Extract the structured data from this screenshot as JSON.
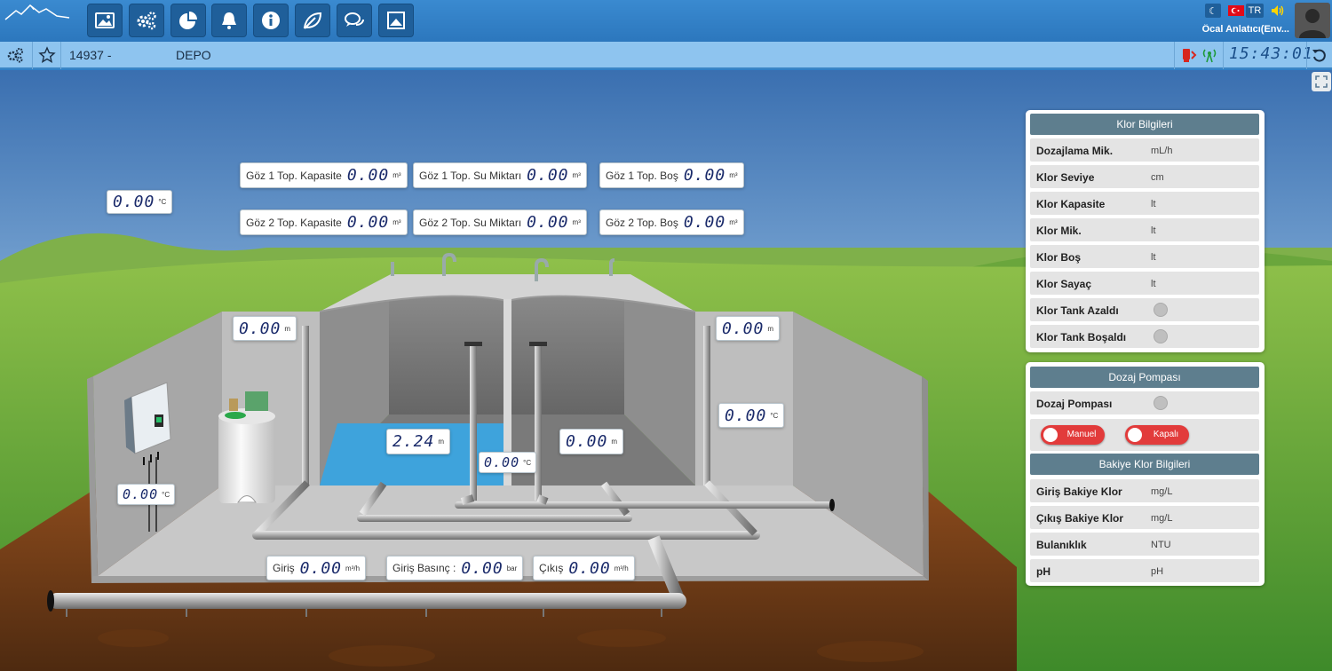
{
  "header": {
    "nav_icons": [
      "image-icon",
      "settings-icon",
      "pie-chart-icon",
      "bell-icon",
      "info-icon",
      "leaf-icon",
      "chat-icon",
      "picture-icon"
    ],
    "lang": "TR",
    "user": "Öcal Anlatıcı(Env..."
  },
  "subbar": {
    "station_id": "14937 -",
    "station_name": "DEPO",
    "clock": "15:43:01"
  },
  "scene": {
    "temp_outside": {
      "value": "0.00",
      "unit": "°C"
    },
    "goz1_kapasite": {
      "label": "Göz 1 Top. Kapasite",
      "value": "0.00",
      "unit": "m³"
    },
    "goz1_su": {
      "label": "Göz 1 Top. Su Miktarı",
      "value": "0.00",
      "unit": "m³"
    },
    "goz1_bos": {
      "label": "Göz 1 Top. Boş",
      "value": "0.00",
      "unit": "m³"
    },
    "goz2_kapasite": {
      "label": "Göz 2 Top. Kapasite",
      "value": "0.00",
      "unit": "m³"
    },
    "goz2_su": {
      "label": "Göz 2 Top. Su Miktarı",
      "value": "0.00",
      "unit": "m³"
    },
    "goz2_bos": {
      "label": "Göz 2 Top. Boş",
      "value": "0.00",
      "unit": "m³"
    },
    "level_left": {
      "value": "0.00",
      "unit": "m"
    },
    "level_right": {
      "value": "0.00",
      "unit": "m"
    },
    "temp_right": {
      "value": "0.00",
      "unit": "°C"
    },
    "level_water": {
      "value": "2.24",
      "unit": "m"
    },
    "temp_water": {
      "value": "0.00",
      "unit": "°C"
    },
    "level_tank2": {
      "value": "0.00",
      "unit": "m"
    },
    "temp_panel": {
      "value": "0.00",
      "unit": "°C"
    },
    "giris": {
      "label": "Giriş",
      "value": "0.00",
      "unit": "m³/h"
    },
    "giris_basinc": {
      "label": "Giriş Basınç :",
      "value": "0.00",
      "unit": "bar"
    },
    "cikis": {
      "label": "Çıkış",
      "value": "0.00",
      "unit": "m³/h"
    }
  },
  "klor": {
    "title": "Klor Bilgileri",
    "rows": [
      {
        "k": "Dozajlama Mik.",
        "u": "mL/h"
      },
      {
        "k": "Klor Seviye",
        "u": "cm"
      },
      {
        "k": "Klor Kapasite",
        "u": "lt"
      },
      {
        "k": "Klor Mik.",
        "u": "lt"
      },
      {
        "k": "Klor Boş",
        "u": "lt"
      },
      {
        "k": "Klor Sayaç",
        "u": "lt"
      },
      {
        "k": "Klor Tank Azaldı",
        "u": ""
      },
      {
        "k": "Klor Tank Boşaldı",
        "u": ""
      }
    ]
  },
  "dozaj": {
    "title": "Dozaj Pompası",
    "row": "Dozaj Pompası",
    "mode": "Manuel",
    "state": "Kapalı"
  },
  "bakiye": {
    "title": "Bakiye Klor Bilgileri",
    "rows": [
      {
        "k": "Giriş Bakiye Klor",
        "u": "mg/L"
      },
      {
        "k": "Çıkış Bakiye Klor",
        "u": "mg/L"
      },
      {
        "k": "Bulanıklık",
        "u": "NTU"
      },
      {
        "k": "pH",
        "u": "pH"
      }
    ]
  },
  "colors": {
    "accent": "#2c77bd",
    "subbar": "#8ec4ef",
    "panel_header": "#5e7e8e",
    "toggle_off": "#e23b3b"
  }
}
